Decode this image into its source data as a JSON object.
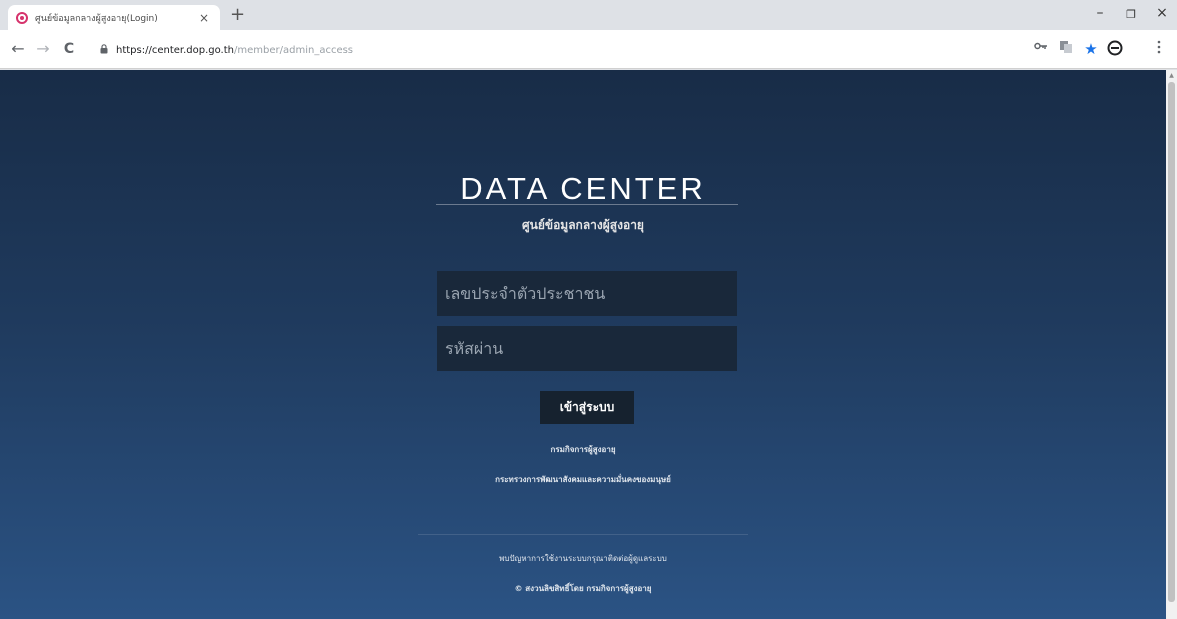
{
  "browser": {
    "tab_title": "ศูนย์ข้อมูลกลางผู้สูงอายุ(Login)",
    "tab_close": "×",
    "new_tab": "+",
    "window_controls": {
      "minimize": "–",
      "maximize": "❐",
      "close": "×"
    },
    "nav": {
      "back": "←",
      "forward": "→",
      "reload": "C"
    },
    "url": {
      "host": "https://center.dop.go.th",
      "path": "/member/admin_access"
    },
    "icons": {
      "key": "key-icon",
      "translate": "translate-icon",
      "star": "star-icon",
      "profile": "profile-icon",
      "menu": "menu-icon"
    }
  },
  "login": {
    "brand": "DATA CENTER",
    "subtitle": "ศูนย์ข้อมูลกลางผู้สูงอายุ",
    "id_placeholder": "เลขประจำตัวประชาชน",
    "password_placeholder": "รหัสผ่าน",
    "submit_label": "เข้าสู่ระบบ",
    "link_department": "กรมกิจการผู้สูงอายุ",
    "link_ministry": "กระทรวงการพัฒนาสังคมและความมั่นคงของมนุษย์",
    "footer_contact": "พบปัญหาการใช้งานระบบกรุณาติดต่อผู้ดูแลระบบ",
    "footer_copyright": "© สงวนลิขสิทธิ์โดย กรมกิจการผู้สูงอายุ"
  },
  "colors": {
    "page_bg_top": "#182c47",
    "page_bg_bottom": "#2b5384",
    "field_bg": "#19283a",
    "button_bg": "#16222f",
    "bookmark_star": "#1a73e8"
  }
}
